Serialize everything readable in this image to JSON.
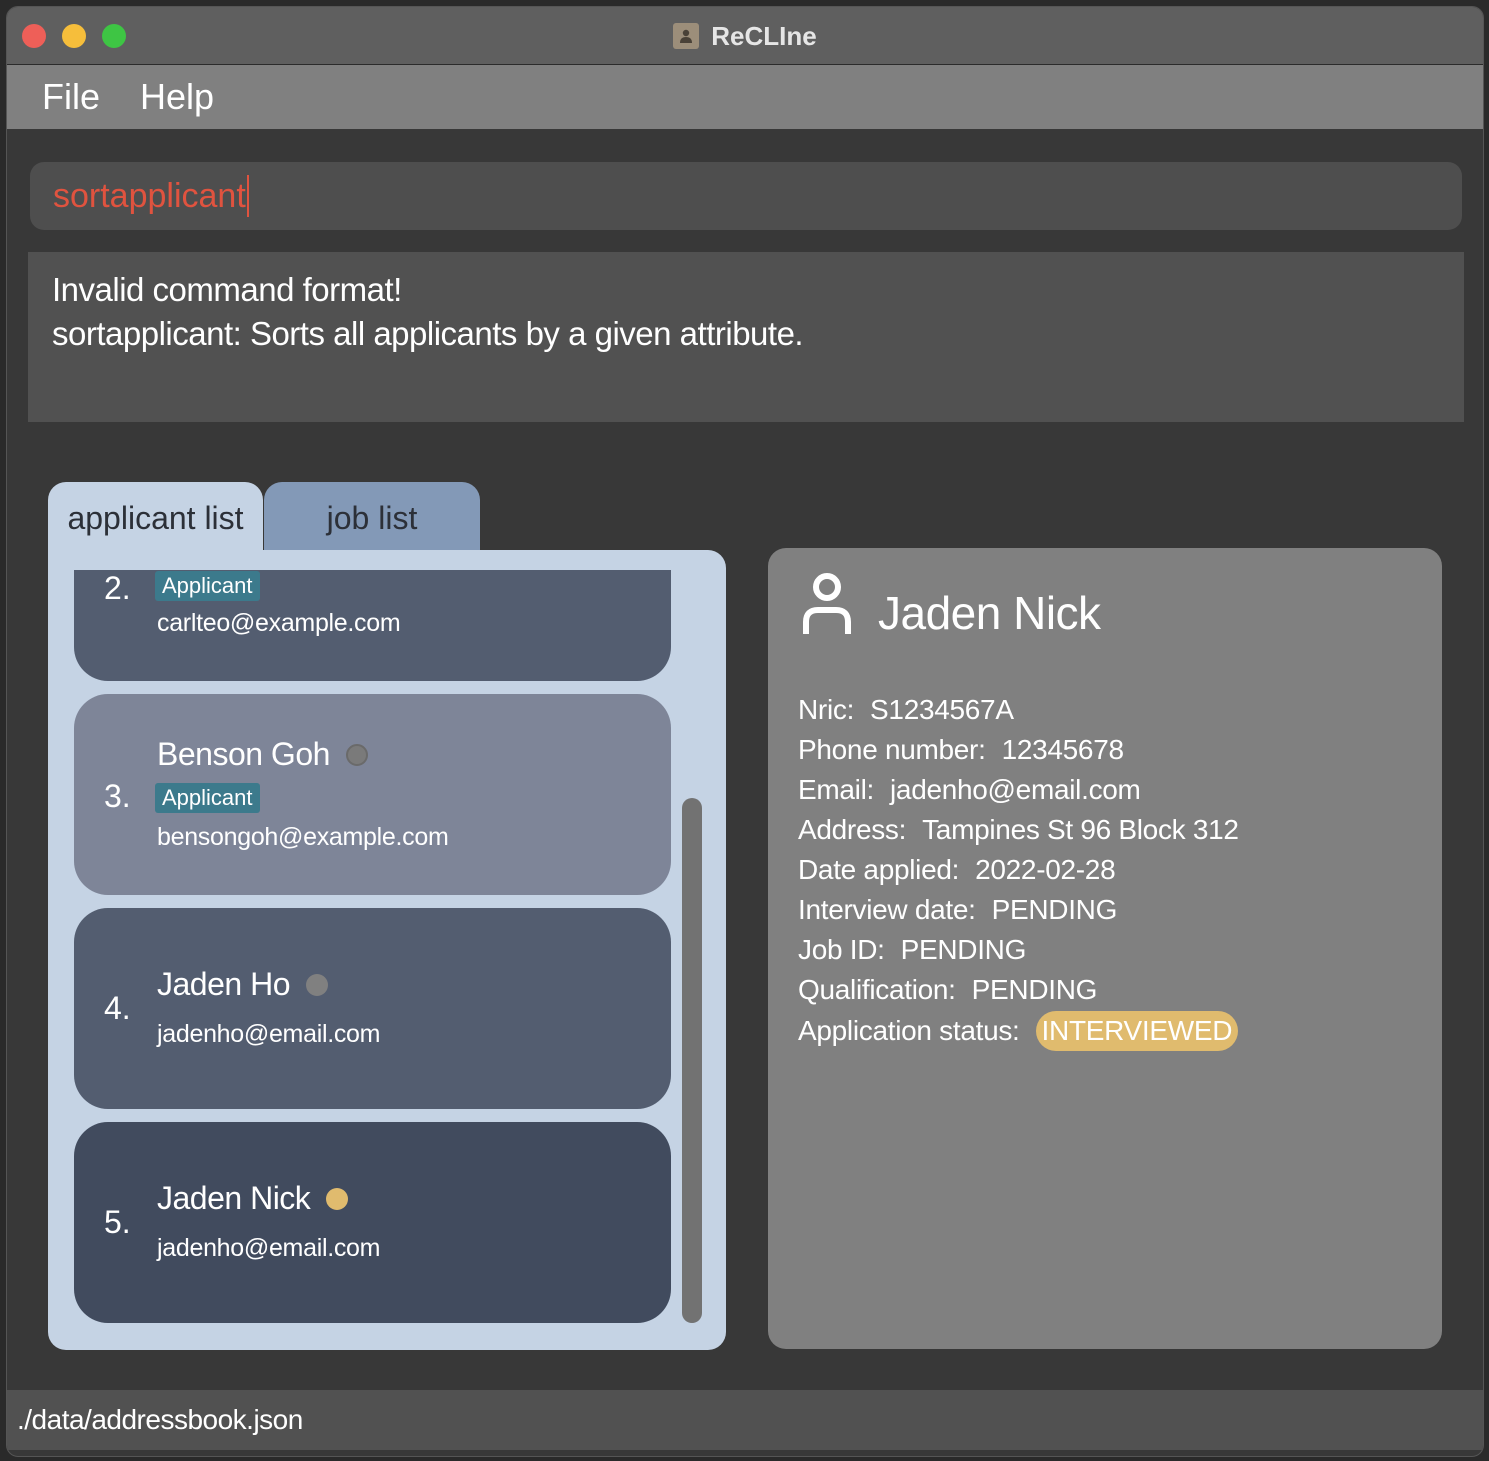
{
  "window": {
    "title": "ReCLIne"
  },
  "menu": {
    "file": "File",
    "help": "Help"
  },
  "command": {
    "value": "sortapplicant"
  },
  "result": {
    "line1": "Invalid command format!",
    "line2": "sortapplicant: Sorts all applicants by a given attribute."
  },
  "tabs": {
    "applicant_list": "applicant list",
    "job_list": "job list"
  },
  "applicants": [
    {
      "index": "2.",
      "tag": "Applicant",
      "email": "carlteo@example.com"
    },
    {
      "index": "3.",
      "name": "Benson Goh",
      "tag": "Applicant",
      "email": "bensongoh@example.com",
      "status_color": "#808080"
    },
    {
      "index": "4.",
      "name": "Jaden Ho",
      "email": "jadenho@email.com",
      "status_color": "#808080"
    },
    {
      "index": "5.",
      "name": "Jaden Nick",
      "email": "jadenho@email.com",
      "status_color": "#e0bb6e"
    }
  ],
  "detail": {
    "name": "Jaden Nick",
    "nric_label": "Nric:",
    "nric": "S1234567A",
    "phone_label": "Phone number:",
    "phone": "12345678",
    "email_label": "Email:",
    "email": "jadenho@email.com",
    "address_label": "Address:",
    "address": "Tampines St 96 Block 312",
    "date_applied_label": "Date applied:",
    "date_applied": "2022-02-28",
    "interview_label": "Interview date:",
    "interview": "PENDING",
    "job_id_label": "Job ID:",
    "job_id": "PENDING",
    "qualification_label": "Qualification:",
    "qualification": "PENDING",
    "status_label": "Application status:",
    "status": "INTERVIEWED"
  },
  "statusbar": {
    "path": "./data/addressbook.json"
  },
  "colors": {
    "accent_command": "#e0533f",
    "tag_bg": "#3c7a8c",
    "interviewed": "#e0bb6e"
  }
}
